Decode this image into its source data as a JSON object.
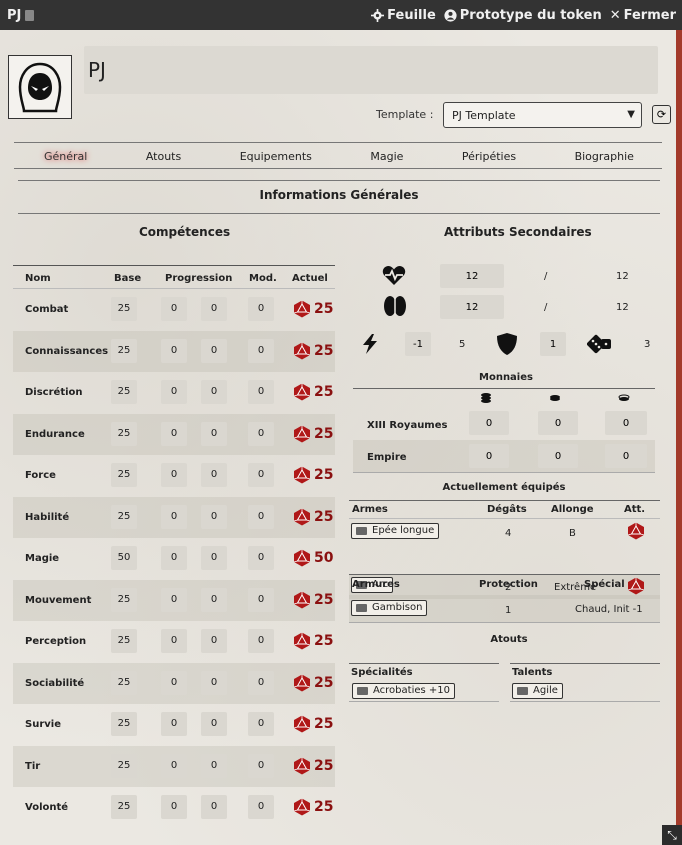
{
  "titlebar": {
    "title": "PJ",
    "sheet_label": "Feuille",
    "token_label": "Prototype du token",
    "close_label": "Fermer"
  },
  "header": {
    "name": "PJ",
    "template_label": "Template :",
    "template_value": "PJ Template"
  },
  "tabs": [
    "Général",
    "Atouts",
    "Equipements",
    "Magie",
    "Péripéties",
    "Biographie"
  ],
  "section_title": "Informations Générales",
  "skills": {
    "title": "Compétences",
    "columns": [
      "Nom",
      "Base",
      "Progression",
      "Mod.",
      "Actuel"
    ],
    "rows": [
      {
        "name": "Combat",
        "base": "25",
        "p1": "0",
        "p2": "0",
        "mod": "0",
        "actual": "25"
      },
      {
        "name": "Connaissances",
        "base": "25",
        "p1": "0",
        "p2": "0",
        "mod": "0",
        "actual": "25"
      },
      {
        "name": "Discrétion",
        "base": "25",
        "p1": "0",
        "p2": "0",
        "mod": "0",
        "actual": "25"
      },
      {
        "name": "Endurance",
        "base": "25",
        "p1": "0",
        "p2": "0",
        "mod": "0",
        "actual": "25"
      },
      {
        "name": "Force",
        "base": "25",
        "p1": "0",
        "p2": "0",
        "mod": "0",
        "actual": "25"
      },
      {
        "name": "Habilité",
        "base": "25",
        "p1": "0",
        "p2": "0",
        "mod": "0",
        "actual": "25"
      },
      {
        "name": "Magie",
        "base": "50",
        "p1": "0",
        "p2": "0",
        "mod": "0",
        "actual": "50"
      },
      {
        "name": "Mouvement",
        "base": "25",
        "p1": "0",
        "p2": "0",
        "mod": "0",
        "actual": "25"
      },
      {
        "name": "Perception",
        "base": "25",
        "p1": "0",
        "p2": "0",
        "mod": "0",
        "actual": "25"
      },
      {
        "name": "Sociabilité",
        "base": "25",
        "p1": "0",
        "p2": "0",
        "mod": "0",
        "actual": "25"
      },
      {
        "name": "Survie",
        "base": "25",
        "p1": "0",
        "p2": "0",
        "mod": "0",
        "actual": "25"
      },
      {
        "name": "Tir",
        "base": "25",
        "p1": "0",
        "p2": "0",
        "mod": "0",
        "actual": "25"
      },
      {
        "name": "Volonté",
        "base": "25",
        "p1": "0",
        "p2": "0",
        "mod": "0",
        "actual": "25"
      }
    ]
  },
  "secondary": {
    "title": "Attributs Secondaires",
    "health": {
      "current": "12",
      "sep": "/",
      "max": "12"
    },
    "mind": {
      "current": "12",
      "sep": "/",
      "max": "12"
    },
    "energy": {
      "mod": "-1",
      "value": "5"
    },
    "armor": {
      "value": "1"
    },
    "luck": {
      "value": "3"
    }
  },
  "money": {
    "title": "Monnaies",
    "rows": [
      {
        "name": "XIII Royaumes",
        "v1": "0",
        "v2": "0",
        "v3": "0"
      },
      {
        "name": "Empire",
        "v1": "0",
        "v2": "0",
        "v3": "0"
      }
    ]
  },
  "equipped": {
    "title": "Actuellement équipés",
    "weapon_cols": [
      "Armes",
      "Dégâts",
      "Allonge",
      "Att."
    ],
    "weapons": [
      {
        "name": "Epée longue",
        "damage": "4",
        "reach": "B"
      },
      {
        "name": "Arc",
        "damage": "2",
        "reach": "Extrême"
      }
    ],
    "armor_cols": [
      "Armures",
      "Protection",
      "Spécial"
    ],
    "armors": [
      {
        "name": "Gambison",
        "protection": "1",
        "special": "Chaud, Init -1"
      }
    ]
  },
  "atouts": {
    "title": "Atouts",
    "spec_label": "Spécialités",
    "spec_item": "Acrobaties +10",
    "talent_label": "Talents",
    "talent_item": "Agile"
  },
  "colors": {
    "accent": "#8a1010",
    "scrollbar": "#a33a2a",
    "titlebar": "#333333"
  }
}
